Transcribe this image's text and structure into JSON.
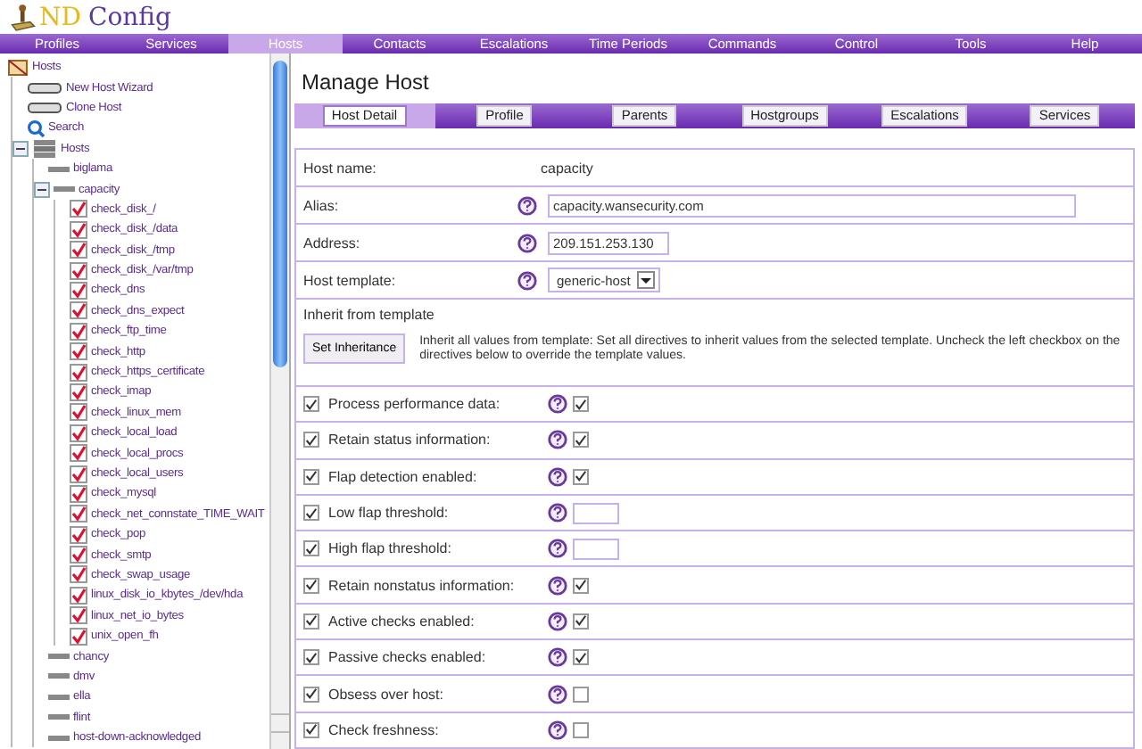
{
  "app": {
    "logo_prefix": "ND",
    "logo_suffix": "Config"
  },
  "nav": [
    {
      "label": "Profiles",
      "selected": false
    },
    {
      "label": "Services",
      "selected": false
    },
    {
      "label": "Hosts",
      "selected": true
    },
    {
      "label": "Contacts",
      "selected": false
    },
    {
      "label": "Escalations",
      "selected": false
    },
    {
      "label": "Time Periods",
      "selected": false
    },
    {
      "label": "Commands",
      "selected": false
    },
    {
      "label": "Control",
      "selected": false
    },
    {
      "label": "Tools",
      "selected": false
    },
    {
      "label": "Help",
      "selected": false
    }
  ],
  "sidebar": {
    "tree": [
      {
        "label": "Hosts",
        "kind": "root",
        "expanded": true,
        "children": [
          {
            "label": "New Host Wizard",
            "kind": "action"
          },
          {
            "label": "Clone Host",
            "kind": "action"
          },
          {
            "label": "Search",
            "kind": "search"
          },
          {
            "label": "Hosts",
            "kind": "group",
            "expanded": true,
            "children": [
              {
                "label": "biglama",
                "kind": "host"
              },
              {
                "label": "capacity",
                "kind": "host",
                "expanded": true,
                "children": [
                  {
                    "label": "check_disk_/",
                    "kind": "service",
                    "checked": true
                  },
                  {
                    "label": "check_disk_/data",
                    "kind": "service",
                    "checked": true
                  },
                  {
                    "label": "check_disk_/tmp",
                    "kind": "service",
                    "checked": true
                  },
                  {
                    "label": "check_disk_/var/tmp",
                    "kind": "service",
                    "checked": true
                  },
                  {
                    "label": "check_dns",
                    "kind": "service",
                    "checked": true
                  },
                  {
                    "label": "check_dns_expect",
                    "kind": "service",
                    "checked": true
                  },
                  {
                    "label": "check_ftp_time",
                    "kind": "service",
                    "checked": true
                  },
                  {
                    "label": "check_http",
                    "kind": "service",
                    "checked": true
                  },
                  {
                    "label": "check_https_certificate",
                    "kind": "service",
                    "checked": true
                  },
                  {
                    "label": "check_imap",
                    "kind": "service",
                    "checked": true
                  },
                  {
                    "label": "check_linux_mem",
                    "kind": "service",
                    "checked": true
                  },
                  {
                    "label": "check_local_load",
                    "kind": "service",
                    "checked": true
                  },
                  {
                    "label": "check_local_procs",
                    "kind": "service",
                    "checked": true
                  },
                  {
                    "label": "check_local_users",
                    "kind": "service",
                    "checked": true
                  },
                  {
                    "label": "check_mysql",
                    "kind": "service",
                    "checked": true
                  },
                  {
                    "label": "check_net_connstate_TIME_WAIT",
                    "kind": "service",
                    "checked": true
                  },
                  {
                    "label": "check_pop",
                    "kind": "service",
                    "checked": true
                  },
                  {
                    "label": "check_smtp",
                    "kind": "service",
                    "checked": true
                  },
                  {
                    "label": "check_swap_usage",
                    "kind": "service",
                    "checked": true
                  },
                  {
                    "label": "linux_disk_io_kbytes_/dev/hda",
                    "kind": "service",
                    "checked": true
                  },
                  {
                    "label": "linux_net_io_bytes",
                    "kind": "service",
                    "checked": true
                  },
                  {
                    "label": "unix_open_fh",
                    "kind": "service",
                    "checked": true
                  }
                ]
              },
              {
                "label": "chancy",
                "kind": "host"
              },
              {
                "label": "dmv",
                "kind": "host"
              },
              {
                "label": "ella",
                "kind": "host"
              },
              {
                "label": "flint",
                "kind": "host"
              },
              {
                "label": "host-down-acknowledged",
                "kind": "host"
              }
            ]
          }
        ]
      }
    ]
  },
  "main": {
    "title": "Manage Host",
    "tabs": [
      {
        "label": "Host Detail",
        "selected": true
      },
      {
        "label": "Profile",
        "selected": false
      },
      {
        "label": "Parents",
        "selected": false
      },
      {
        "label": "Hostgroups",
        "selected": false
      },
      {
        "label": "Escalations",
        "selected": false
      },
      {
        "label": "Services",
        "selected": false
      }
    ],
    "fields": [
      {
        "label": "Host name:",
        "kind": "static",
        "value": "capacity"
      },
      {
        "label": "Alias:",
        "kind": "text",
        "value": "capacity.wansecurity.com"
      },
      {
        "label": "Address:",
        "kind": "short",
        "value": "209.151.253.130"
      },
      {
        "label": "Host template:",
        "kind": "select",
        "value": "generic-host"
      }
    ],
    "inherit": {
      "heading": "Inherit from template",
      "button": "Set Inheritance",
      "text": "Inherit all values from template: Set all directives to inherit values from the selected template. Uncheck the left checkbox on the directives below to override the template values."
    },
    "directives": [
      {
        "label": "Process performance data:",
        "inherit": true,
        "kind": "checkbox",
        "checked": true
      },
      {
        "label": "Retain status information:",
        "inherit": true,
        "kind": "checkbox",
        "checked": true
      },
      {
        "label": "Flap detection enabled:",
        "inherit": true,
        "kind": "checkbox",
        "checked": true
      },
      {
        "label": "Low flap threshold:",
        "inherit": true,
        "kind": "number"
      },
      {
        "label": "High flap threshold:",
        "inherit": true,
        "kind": "number"
      },
      {
        "label": "Retain nonstatus information:",
        "inherit": true,
        "kind": "checkbox",
        "checked": true
      },
      {
        "label": "Active checks enabled:",
        "inherit": true,
        "kind": "checkbox",
        "checked": true
      },
      {
        "label": "Passive checks enabled:",
        "inherit": true,
        "kind": "checkbox",
        "checked": true
      },
      {
        "label": "Obsess over host:",
        "inherit": true,
        "kind": "checkbox",
        "checked": false
      },
      {
        "label": "Check freshness:",
        "inherit": true,
        "kind": "checkbox",
        "checked": false
      }
    ]
  }
}
